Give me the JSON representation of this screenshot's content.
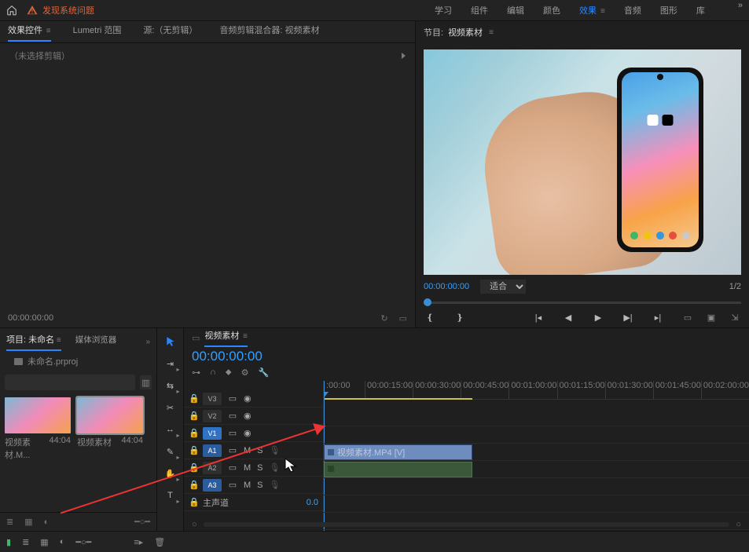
{
  "topbar": {
    "warning": "发现系统问题",
    "workspaces": [
      "学习",
      "组件",
      "编辑",
      "颜色",
      "效果",
      "音频",
      "图形",
      "库"
    ],
    "active_ws_index": 4
  },
  "effect_panel": {
    "tabs": [
      "效果控件",
      "Lumetri 范围",
      "源:（无剪辑）",
      "音频剪辑混合器: 视频素材"
    ],
    "active_tab_index": 0,
    "no_selection": "（未选择剪辑）",
    "tc": "00:00:00:00"
  },
  "program_monitor": {
    "title_prefix": "节目:",
    "title": "视频素材",
    "tc": "00:00:00:00",
    "fit_label": "适合",
    "page": "1/2"
  },
  "project_panel": {
    "tabs": [
      "项目: 未命名",
      "媒体浏览器"
    ],
    "file": "未命名.prproj",
    "search_placeholder": "",
    "bins": [
      {
        "name": "视频素材.M...",
        "dur": "44:04",
        "selected": false
      },
      {
        "name": "视频素材",
        "dur": "44:04",
        "selected": true
      }
    ]
  },
  "timeline": {
    "tab": "视频素材",
    "tc": "00:00:00:00",
    "ruler": [
      ":00:00",
      "00:00:15:00",
      "00:00:30:00",
      "00:00:45:00",
      "00:01:00:00",
      "00:01:15:00",
      "00:01:30:00",
      "00:01:45:00",
      "00:02:00:00"
    ],
    "tracks_v": [
      "V3",
      "V2",
      "V1"
    ],
    "tracks_a": [
      "A1",
      "A2",
      "A3"
    ],
    "master": "主声道",
    "master_vol": "0.0",
    "clip_v_label": "视频素材.MP4 [V]",
    "m_label": "M",
    "s_label": "S"
  }
}
